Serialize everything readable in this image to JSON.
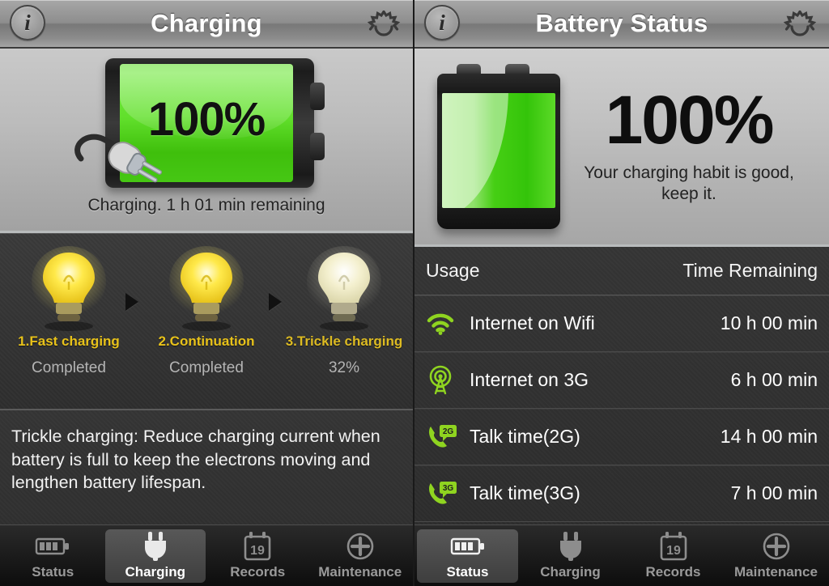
{
  "left_panel": {
    "navbar": {
      "title": "Charging",
      "info_icon": "info-icon",
      "info_glyph": "i",
      "gear_icon": "gear-icon"
    },
    "hero": {
      "percent": "100%",
      "caption": "Charging. 1 h 01 min remaining",
      "battery_icon": "horizontal-battery-icon",
      "plug_icon": "power-plug-icon"
    },
    "steps": [
      {
        "title": "1.Fast charging",
        "status": "Completed",
        "bulb_icon": "lightbulb-on-icon"
      },
      {
        "title": "2.Continuation",
        "status": "Completed",
        "bulb_icon": "lightbulb-on-icon"
      },
      {
        "title": "3.Trickle charging",
        "status": "32%",
        "bulb_icon": "lightbulb-dim-icon"
      }
    ],
    "description": "Trickle charging: Reduce charging current when battery is full to keep the electrons moving and lengthen battery lifespan.",
    "tabs": [
      {
        "label": "Status",
        "icon": "battery-icon",
        "active": false
      },
      {
        "label": "Charging",
        "icon": "plug-icon",
        "active": true
      },
      {
        "label": "Records",
        "icon": "calendar-icon",
        "icon_text": "19",
        "active": false
      },
      {
        "label": "Maintenance",
        "icon": "plus-circle-icon",
        "active": false
      }
    ]
  },
  "right_panel": {
    "navbar": {
      "title": "Battery Status",
      "info_icon": "info-icon",
      "info_glyph": "i",
      "gear_icon": "gear-icon"
    },
    "hero": {
      "percent": "100%",
      "habit_text": "Your charging habit is good, keep it.",
      "battery_icon": "vertical-battery-icon"
    },
    "usage_table": {
      "header_usage": "Usage",
      "header_time": "Time Remaining",
      "rows": [
        {
          "label": "Internet on Wifi",
          "value": "10 h 00 min",
          "icon": "wifi-icon"
        },
        {
          "label": "Internet on 3G",
          "value": "6 h 00 min",
          "icon": "cell-tower-icon"
        },
        {
          "label": "Talk time(2G)",
          "value": "14 h 00 min",
          "icon": "phone-2g-icon",
          "badge": "2G"
        },
        {
          "label": "Talk time(3G)",
          "value": "7 h 00 min",
          "icon": "phone-3g-icon",
          "badge": "3G"
        }
      ]
    },
    "tabs": [
      {
        "label": "Status",
        "icon": "battery-icon",
        "active": true
      },
      {
        "label": "Charging",
        "icon": "plug-icon",
        "active": false
      },
      {
        "label": "Records",
        "icon": "calendar-icon",
        "icon_text": "19",
        "active": false
      },
      {
        "label": "Maintenance",
        "icon": "plus-circle-icon",
        "active": false
      }
    ]
  },
  "colors": {
    "accent_green": "#8fd420",
    "battery_green": "#46cf14",
    "step_yellow": "#e8c21a",
    "dark_bg": "#333333",
    "nav_gray": "#8e8e8e"
  }
}
